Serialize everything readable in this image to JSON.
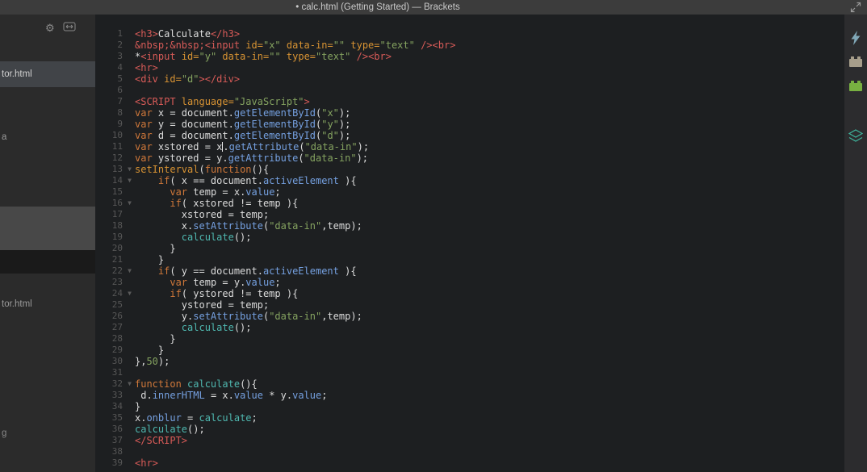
{
  "colors": {
    "titlebar_bg": "#3c3c3c",
    "titlebar_fg": "#c9c9c9",
    "sidebar_bg": "#2b2b2b",
    "sidebar_selected_bg": "#414448",
    "editor_bg": "#1d1f21",
    "right_toolbar_bg": "#2c2c2e",
    "line_number": "#565656",
    "tok_plain": "#dcdcdc",
    "tok_tag": "#d85b58",
    "tok_attr": "#d89333",
    "tok_kw": "#d0783a",
    "tok_str": "#85a360",
    "tok_num": "#85a360",
    "tok_prop": "#75a0e0",
    "tok_fn": "#4fb8b0",
    "live_preview_icon": "#81a8b8",
    "extension_brick_icon": "#a79e8b",
    "extension_green_icon": "#78b041",
    "extension_teal_icon": "#3eb39b"
  },
  "titlebar": {
    "title": "• calc.html (Getting Started) — Brackets"
  },
  "sidebar": {
    "gear_glyph": "⚙",
    "items": [
      {
        "label": "tor.html"
      },
      {
        "label": "a"
      },
      {
        "label": "tor.html"
      },
      {
        "label": "g"
      }
    ]
  },
  "editor": {
    "file": "calc.html",
    "lines": [
      {
        "n": 1,
        "fold": false,
        "t": [
          [
            "tag",
            "<h3>"
          ],
          [
            "plain",
            "Calculate"
          ],
          [
            "tag",
            "</h3>"
          ]
        ]
      },
      {
        "n": 2,
        "fold": false,
        "t": [
          [
            "ent",
            "&nbsp;&nbsp;"
          ],
          [
            "tag",
            "<input "
          ],
          [
            "attr",
            "id="
          ],
          [
            "str",
            "\"x\""
          ],
          [
            "attr",
            " data-in="
          ],
          [
            "str",
            "\"\""
          ],
          [
            "attr",
            " type="
          ],
          [
            "str",
            "\"text\""
          ],
          [
            "tag",
            " /><br>"
          ]
        ]
      },
      {
        "n": 3,
        "fold": false,
        "t": [
          [
            "plain",
            "*"
          ],
          [
            "tag",
            "<input "
          ],
          [
            "attr",
            "id="
          ],
          [
            "str",
            "\"y\""
          ],
          [
            "attr",
            " data-in="
          ],
          [
            "str",
            "\"\""
          ],
          [
            "attr",
            " type="
          ],
          [
            "str",
            "\"text\""
          ],
          [
            "tag",
            " /><br>"
          ]
        ]
      },
      {
        "n": 4,
        "fold": false,
        "t": [
          [
            "tag",
            "<hr>"
          ]
        ]
      },
      {
        "n": 5,
        "fold": false,
        "t": [
          [
            "tag",
            "<div "
          ],
          [
            "attr",
            "id="
          ],
          [
            "str",
            "\"d\""
          ],
          [
            "tag",
            "></div>"
          ]
        ]
      },
      {
        "n": 6,
        "fold": false,
        "t": []
      },
      {
        "n": 7,
        "fold": false,
        "t": [
          [
            "tag",
            "<SCRIPT "
          ],
          [
            "attr",
            "language="
          ],
          [
            "str",
            "\"JavaScript\""
          ],
          [
            "tag",
            ">"
          ]
        ]
      },
      {
        "n": 8,
        "fold": false,
        "t": [
          [
            "kw",
            "var"
          ],
          [
            "plain",
            " x = document."
          ],
          [
            "prop",
            "getElementById"
          ],
          [
            "plain",
            "("
          ],
          [
            "str",
            "\"x\""
          ],
          [
            "plain",
            ");"
          ]
        ]
      },
      {
        "n": 9,
        "fold": false,
        "t": [
          [
            "kw",
            "var"
          ],
          [
            "plain",
            " y = document."
          ],
          [
            "prop",
            "getElementById"
          ],
          [
            "plain",
            "("
          ],
          [
            "str",
            "\"y\""
          ],
          [
            "plain",
            ");"
          ]
        ]
      },
      {
        "n": 10,
        "fold": false,
        "t": [
          [
            "kw",
            "var"
          ],
          [
            "plain",
            " d = document."
          ],
          [
            "prop",
            "getElementById"
          ],
          [
            "plain",
            "("
          ],
          [
            "str",
            "\"d\""
          ],
          [
            "plain",
            ");"
          ]
        ]
      },
      {
        "n": 11,
        "fold": false,
        "t": [
          [
            "kw",
            "var"
          ],
          [
            "plain",
            " xstored = x"
          ],
          [
            "cursor",
            ""
          ],
          [
            "plain",
            "."
          ],
          [
            "prop",
            "getAttribute"
          ],
          [
            "plain",
            "("
          ],
          [
            "str",
            "\"data-in\""
          ],
          [
            "plain",
            ");"
          ]
        ]
      },
      {
        "n": 12,
        "fold": false,
        "t": [
          [
            "kw",
            "var"
          ],
          [
            "plain",
            " ystored = y."
          ],
          [
            "prop",
            "getAttribute"
          ],
          [
            "plain",
            "("
          ],
          [
            "str",
            "\"data-in\""
          ],
          [
            "plain",
            ");"
          ]
        ]
      },
      {
        "n": 13,
        "fold": true,
        "t": [
          [
            "builtin",
            "setInterval"
          ],
          [
            "plain",
            "("
          ],
          [
            "kw",
            "function"
          ],
          [
            "plain",
            "(){"
          ]
        ]
      },
      {
        "n": 14,
        "fold": true,
        "t": [
          [
            "plain",
            "    "
          ],
          [
            "kw",
            "if"
          ],
          [
            "plain",
            "( x == document."
          ],
          [
            "prop",
            "activeElement"
          ],
          [
            "plain",
            " ){"
          ]
        ]
      },
      {
        "n": 15,
        "fold": false,
        "t": [
          [
            "plain",
            "      "
          ],
          [
            "kw",
            "var"
          ],
          [
            "plain",
            " temp = x."
          ],
          [
            "prop",
            "value"
          ],
          [
            "plain",
            ";"
          ]
        ]
      },
      {
        "n": 16,
        "fold": true,
        "t": [
          [
            "plain",
            "      "
          ],
          [
            "kw",
            "if"
          ],
          [
            "plain",
            "( xstored != temp ){"
          ]
        ]
      },
      {
        "n": 17,
        "fold": false,
        "t": [
          [
            "plain",
            "        xstored = temp;"
          ]
        ]
      },
      {
        "n": 18,
        "fold": false,
        "t": [
          [
            "plain",
            "        x."
          ],
          [
            "prop",
            "setAttribute"
          ],
          [
            "plain",
            "("
          ],
          [
            "str",
            "\"data-in\""
          ],
          [
            "plain",
            ",temp);"
          ]
        ]
      },
      {
        "n": 19,
        "fold": false,
        "t": [
          [
            "plain",
            "        "
          ],
          [
            "fn",
            "calculate"
          ],
          [
            "plain",
            "();"
          ]
        ]
      },
      {
        "n": 20,
        "fold": false,
        "t": [
          [
            "plain",
            "      }"
          ]
        ]
      },
      {
        "n": 21,
        "fold": false,
        "t": [
          [
            "plain",
            "    }"
          ]
        ]
      },
      {
        "n": 22,
        "fold": true,
        "t": [
          [
            "plain",
            "    "
          ],
          [
            "kw",
            "if"
          ],
          [
            "plain",
            "( y == document."
          ],
          [
            "prop",
            "activeElement"
          ],
          [
            "plain",
            " ){"
          ]
        ]
      },
      {
        "n": 23,
        "fold": false,
        "t": [
          [
            "plain",
            "      "
          ],
          [
            "kw",
            "var"
          ],
          [
            "plain",
            " temp = y."
          ],
          [
            "prop",
            "value"
          ],
          [
            "plain",
            ";"
          ]
        ]
      },
      {
        "n": 24,
        "fold": true,
        "t": [
          [
            "plain",
            "      "
          ],
          [
            "kw",
            "if"
          ],
          [
            "plain",
            "( ystored != temp ){"
          ]
        ]
      },
      {
        "n": 25,
        "fold": false,
        "t": [
          [
            "plain",
            "        ystored = temp;"
          ]
        ]
      },
      {
        "n": 26,
        "fold": false,
        "t": [
          [
            "plain",
            "        y."
          ],
          [
            "prop",
            "setAttribute"
          ],
          [
            "plain",
            "("
          ],
          [
            "str",
            "\"data-in\""
          ],
          [
            "plain",
            ",temp);"
          ]
        ]
      },
      {
        "n": 27,
        "fold": false,
        "t": [
          [
            "plain",
            "        "
          ],
          [
            "fn",
            "calculate"
          ],
          [
            "plain",
            "();"
          ]
        ]
      },
      {
        "n": 28,
        "fold": false,
        "t": [
          [
            "plain",
            "      }"
          ]
        ]
      },
      {
        "n": 29,
        "fold": false,
        "t": [
          [
            "plain",
            "    }"
          ]
        ]
      },
      {
        "n": 30,
        "fold": false,
        "t": [
          [
            "plain",
            "},"
          ],
          [
            "num",
            "50"
          ],
          [
            "plain",
            ");"
          ]
        ]
      },
      {
        "n": 31,
        "fold": false,
        "t": []
      },
      {
        "n": 32,
        "fold": true,
        "t": [
          [
            "kw",
            "function"
          ],
          [
            "plain",
            " "
          ],
          [
            "fn",
            "calculate"
          ],
          [
            "plain",
            "(){"
          ]
        ]
      },
      {
        "n": 33,
        "fold": false,
        "t": [
          [
            "plain",
            " d."
          ],
          [
            "prop",
            "innerHTML"
          ],
          [
            "plain",
            " = x."
          ],
          [
            "prop",
            "value"
          ],
          [
            "plain",
            " * y."
          ],
          [
            "prop",
            "value"
          ],
          [
            "plain",
            ";"
          ]
        ]
      },
      {
        "n": 34,
        "fold": false,
        "t": [
          [
            "plain",
            "}"
          ]
        ]
      },
      {
        "n": 35,
        "fold": false,
        "t": [
          [
            "plain",
            "x."
          ],
          [
            "prop",
            "onblur"
          ],
          [
            "plain",
            " = "
          ],
          [
            "fn",
            "calculate"
          ],
          [
            "plain",
            ";"
          ]
        ]
      },
      {
        "n": 36,
        "fold": false,
        "t": [
          [
            "fn",
            "calculate"
          ],
          [
            "plain",
            "();"
          ]
        ]
      },
      {
        "n": 37,
        "fold": false,
        "t": [
          [
            "tag",
            "</SCRIPT>"
          ]
        ]
      },
      {
        "n": 38,
        "fold": false,
        "t": []
      },
      {
        "n": 39,
        "fold": false,
        "t": [
          [
            "tag",
            "<hr>"
          ]
        ]
      }
    ]
  },
  "right_toolbar": {
    "icons": [
      {
        "name": "live-preview-icon"
      },
      {
        "name": "extension-manager-icon"
      },
      {
        "name": "extension-green-brick-icon"
      },
      {
        "name": "extension-teal-layers-icon"
      }
    ]
  }
}
